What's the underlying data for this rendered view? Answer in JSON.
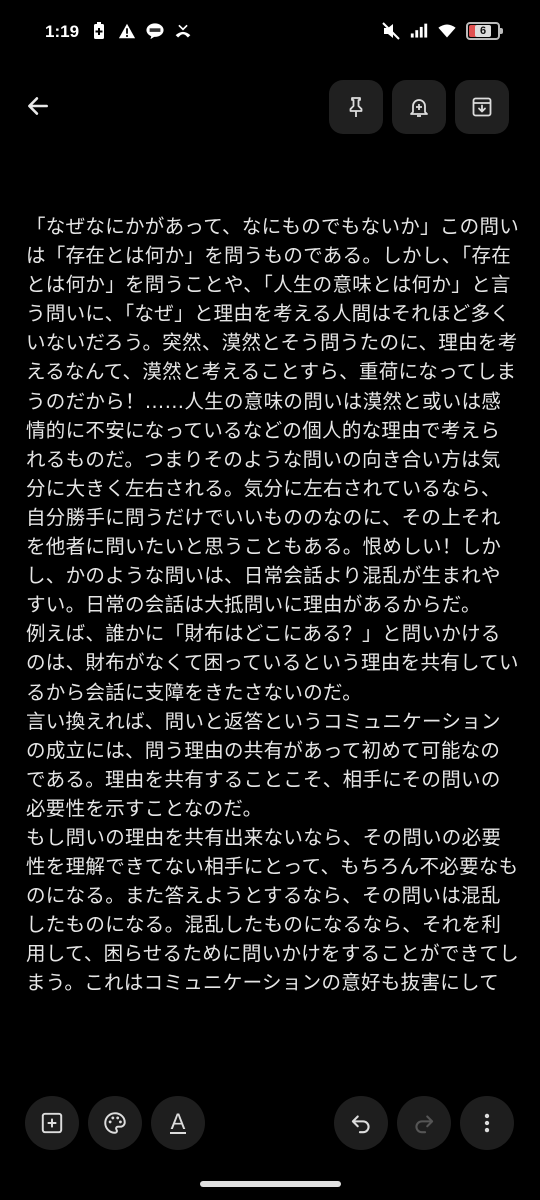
{
  "status_bar": {
    "time": "1:19",
    "battery_level": "6",
    "left_icons": [
      "battery-saver-icon",
      "warning-icon",
      "line-app-icon",
      "missed-call-icon"
    ],
    "right_icons": [
      "mute-icon",
      "cellular-signal-icon",
      "wifi-icon",
      "battery-icon"
    ]
  },
  "top_bar": {
    "icons": [
      "back-arrow-icon",
      "pin-icon",
      "reminder-bell-icon",
      "archive-icon"
    ]
  },
  "note": {
    "body": "「なぜなにかがあって、なにものでもないか」この問いは「存在とは何か」を問うものである。しかし、「存在とは何か」を問うことや、「人生の意味とは何か」と言う問いに、「なぜ」と理由を考える人間はそれほど多くいないだろう。突然、漠然とそう問うたのに、理由を考えるなんて、漠然と考えることすら、重荷になってしまうのだから！……人生の意味の問いは漠然と或いは感情的に不安になっているなどの個人的な理由で考えられるものだ。つまりそのような問いの向き合い方は気分に大きく左右される。気分に左右されているなら、自分勝手に問うだけでいいもののなのに、その上それを他者に問いたいと思うこともある。恨めしい！しかし、かのような問いは、日常会話より混乱が生まれやすい。日常の会話は大抵問いに理由があるからだ。\n例えば、誰かに「財布はどこにある？」と問いかけるのは、財布がなくて困っているという理由を共有しているから会話に支障をきたさないのだ。\n言い換えれば、問いと返答というコミュニケーションの成立には、問う理由の共有があって初めて可能なのである。理由を共有することこそ、相手にその問いの必要性を示すことなのだ。\nもし問いの理由を共有出来ないなら、その問いの必要性を理解できてない相手にとって、もちろん不必要なものになる。また答えようとするなら、その問いは混乱したものになる。混乱したものになるなら、それを利用して、困らせるために問いかけをすることができてしまう。これはコミュニケーションの意好も抜害にして"
  },
  "bottom_bar": {
    "format_label": "A",
    "icons": [
      "add-box-icon",
      "palette-icon",
      "text-format-icon",
      "undo-icon",
      "redo-icon",
      "more-vert-icon"
    ]
  },
  "colors": {
    "background": "#000000",
    "text": "#e6e6e6",
    "button_bg": "#202020"
  }
}
